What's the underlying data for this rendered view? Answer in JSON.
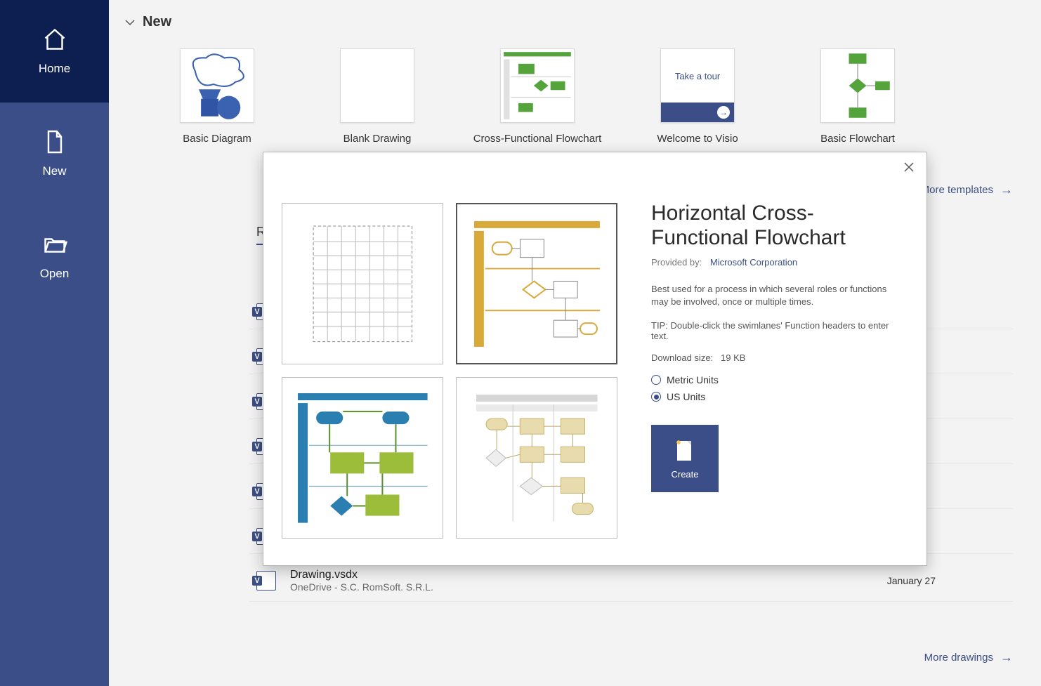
{
  "sidebar": {
    "items": [
      {
        "label": "Home",
        "icon": "home-icon"
      },
      {
        "label": "New",
        "icon": "document-icon"
      },
      {
        "label": "Open",
        "icon": "folder-open-icon"
      }
    ]
  },
  "section": {
    "new_label": "New",
    "recent_label": "Recent"
  },
  "templates": [
    {
      "label": "Basic Diagram"
    },
    {
      "label": "Blank Drawing"
    },
    {
      "label": "Cross-Functional Flowchart"
    },
    {
      "label": "Welcome to Visio",
      "tour_text": "Take a tour"
    },
    {
      "label": "Basic Flowchart"
    }
  ],
  "more_templates": "More templates",
  "more_drawings": "More drawings",
  "recent": {
    "file_name": "Drawing.vsdx",
    "file_path": "OneDrive - S.C. RomSoft. S.R.L.",
    "date": "January 27"
  },
  "modal": {
    "title": "Horizontal Cross-Functional Flowchart",
    "provided_by_label": "Provided by:",
    "provided_by_value": "Microsoft Corporation",
    "description": "Best used for a process in which several roles or functions may be involved, once or multiple times.",
    "tip": "TIP: Double-click the swimlanes' Function headers to enter text.",
    "download_label": "Download size:",
    "download_size": "19 KB",
    "units": {
      "metric": "Metric Units",
      "us": "US Units",
      "selected": "us"
    },
    "create_label": "Create",
    "variants": [
      {
        "name": "vertical-basic",
        "selected": false
      },
      {
        "name": "horizontal-yellow",
        "selected": true
      },
      {
        "name": "colorful-green-blue",
        "selected": false
      },
      {
        "name": "grey-vertical",
        "selected": false
      }
    ]
  }
}
